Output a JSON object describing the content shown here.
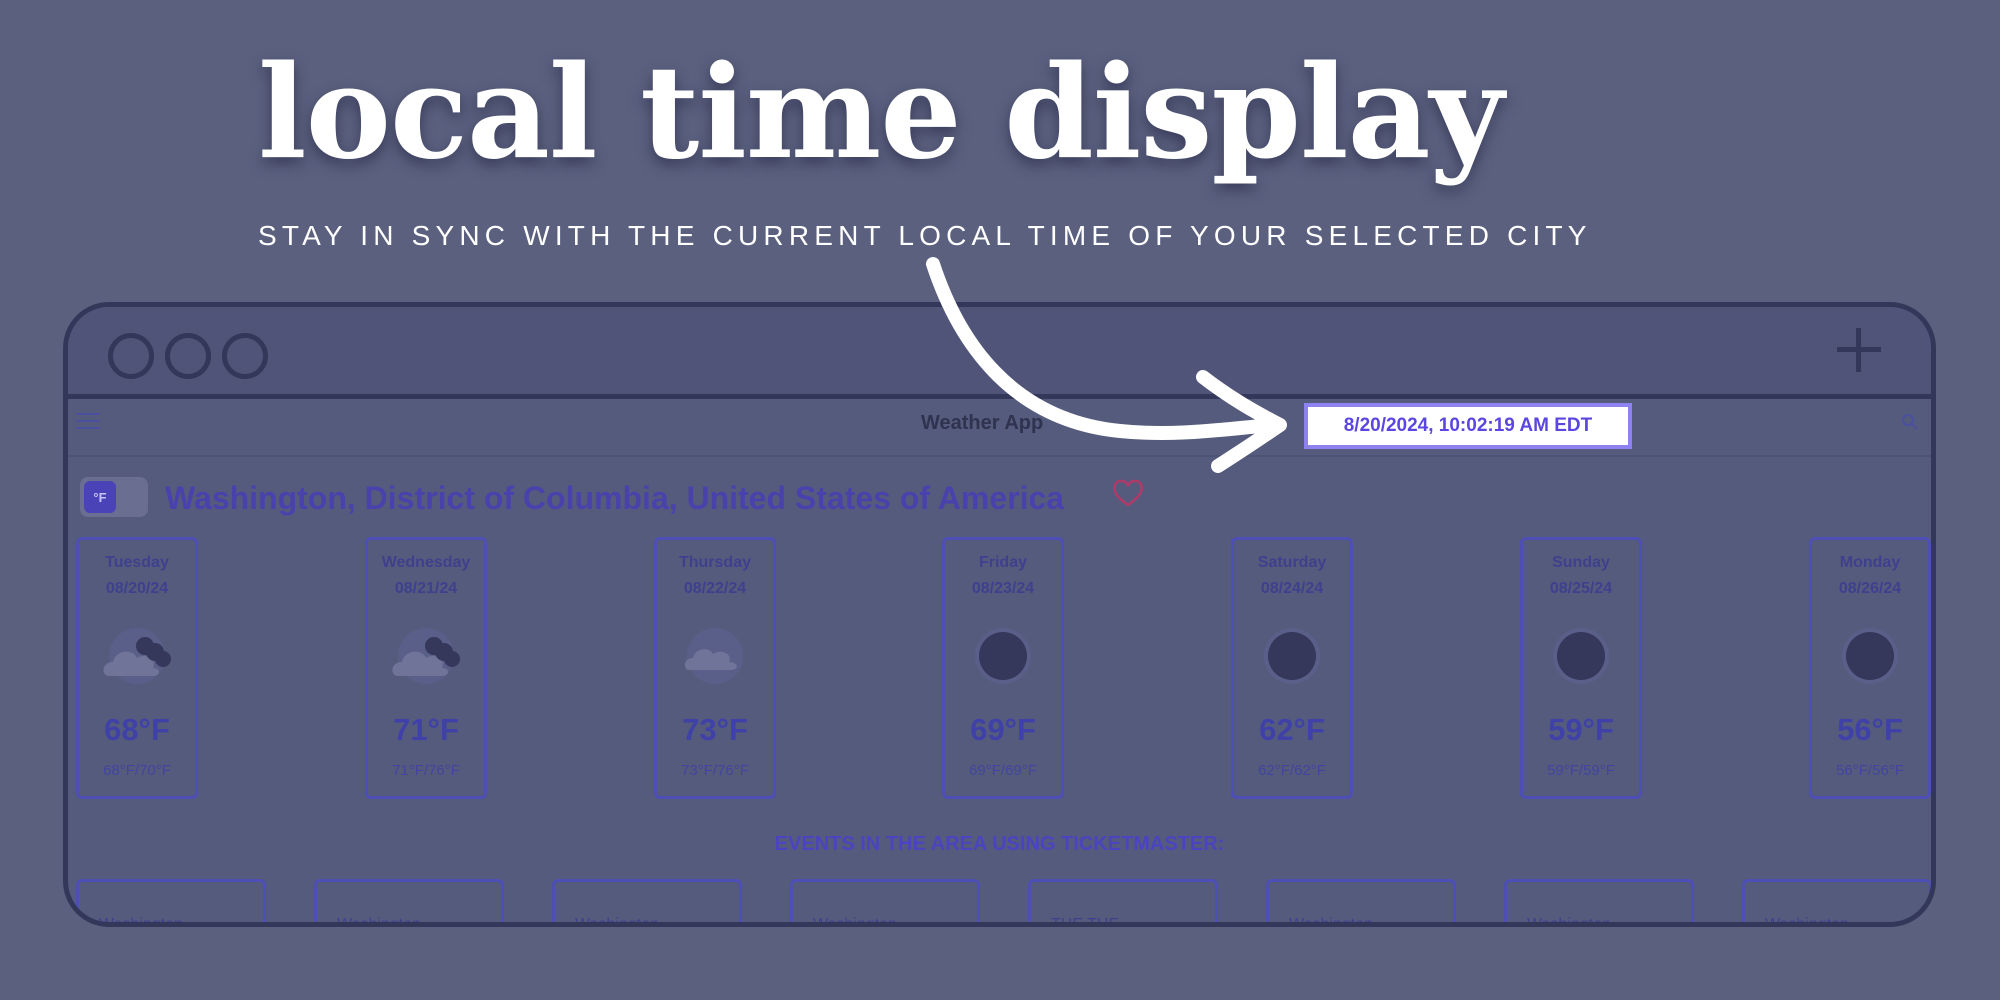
{
  "promo": {
    "headline": "local time display",
    "subhead": "STAY IN SYNC WITH THE CURRENT LOCAL TIME OF YOUR SELECTED CITY"
  },
  "app": {
    "title": "Weather App",
    "local_time": "8/20/2024, 10:02:19 AM EDT",
    "unit": "°F",
    "location": "Washington, District of Columbia, United States of America",
    "events_title": "EVENTS IN THE AREA USING TICKETMASTER:"
  },
  "forecast": [
    {
      "day": "Tuesday",
      "date": "08/20/24",
      "icon": "partly-cloudy-night-icon",
      "temp": "68°F",
      "range": "68°F/70°F"
    },
    {
      "day": "Wednesday",
      "date": "08/21/24",
      "icon": "partly-cloudy-night-icon",
      "temp": "71°F",
      "range": "71°F/76°F"
    },
    {
      "day": "Thursday",
      "date": "08/22/24",
      "icon": "cloud-icon",
      "temp": "73°F",
      "range": "73°F/76°F"
    },
    {
      "day": "Friday",
      "date": "08/23/24",
      "icon": "clear-night-icon",
      "temp": "69°F",
      "range": "69°F/69°F"
    },
    {
      "day": "Saturday",
      "date": "08/24/24",
      "icon": "clear-night-icon",
      "temp": "62°F",
      "range": "62°F/62°F"
    },
    {
      "day": "Sunday",
      "date": "08/25/24",
      "icon": "clear-night-icon",
      "temp": "59°F",
      "range": "59°F/59°F"
    },
    {
      "day": "Monday",
      "date": "08/26/24",
      "icon": "clear-night-icon",
      "temp": "56°F",
      "range": "56°F/56°F"
    }
  ],
  "events": [
    {
      "name": "Washington"
    },
    {
      "name": "Washington"
    },
    {
      "name": "Washington"
    },
    {
      "name": "Washington"
    },
    {
      "name": "THE THE"
    },
    {
      "name": "Washington"
    },
    {
      "name": "Washington"
    },
    {
      "name": "Washington"
    }
  ],
  "colors": {
    "background": "#5a607e",
    "accent": "#5b47e0",
    "time_border": "#8e82f0",
    "heart": "#b03a6a"
  }
}
